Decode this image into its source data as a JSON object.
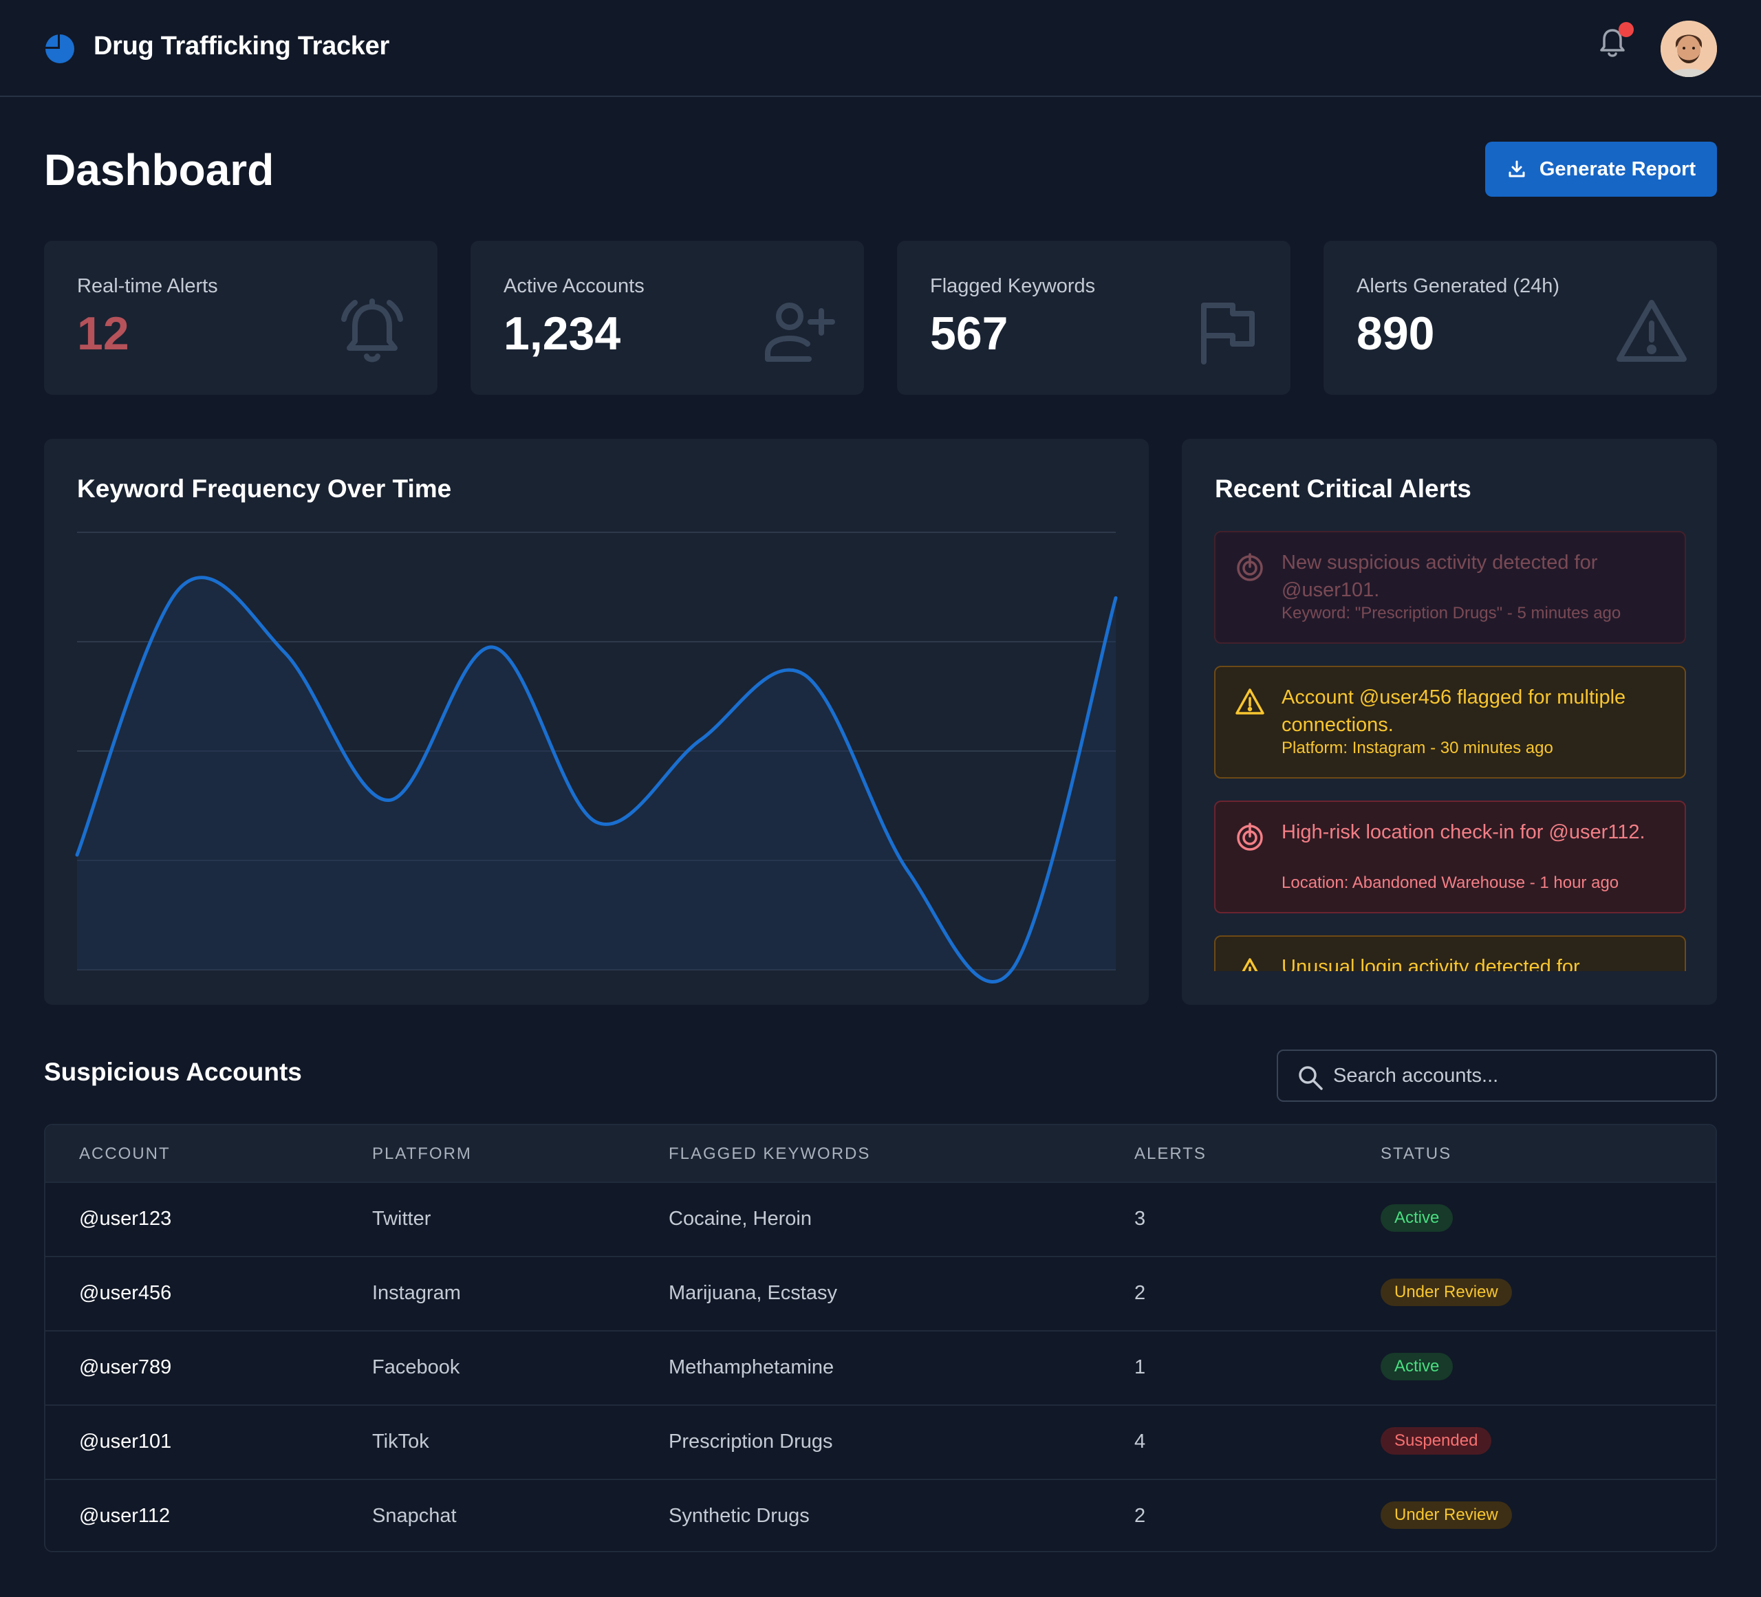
{
  "app": {
    "title": "Drug Trafficking Tracker"
  },
  "header": {
    "notification_icon": "bell-icon",
    "has_unread": true
  },
  "page": {
    "title": "Dashboard",
    "generate_report_label": "Generate Report"
  },
  "stats": [
    {
      "label": "Real-time Alerts",
      "value": "12",
      "icon": "bell-ringing-icon",
      "value_color": "#b5525a"
    },
    {
      "label": "Active Accounts",
      "value": "1,234",
      "icon": "user-plus-icon"
    },
    {
      "label": "Flagged Keywords",
      "value": "567",
      "icon": "flag-icon"
    },
    {
      "label": "Alerts Generated (24h)",
      "value": "890",
      "icon": "warning-triangle-icon"
    }
  ],
  "chart": {
    "title": "Keyword Frequency Over Time"
  },
  "chart_data": {
    "type": "line",
    "title": "Keyword Frequency Over Time",
    "xlabel": "",
    "ylabel": "",
    "grid": true,
    "gridlines": 5,
    "color": "#1a6fd0",
    "x": [
      0,
      0.1,
      0.2,
      0.3,
      0.4,
      0.5,
      0.6,
      0.7,
      0.8,
      0.9,
      1.0
    ],
    "series": [
      {
        "values": [
          1.05,
          3.5,
          2.9,
          1.55,
          2.95,
          1.35,
          2.1,
          2.7,
          0.9,
          0.0,
          3.4
        ]
      }
    ],
    "ylim": [
      0,
      4
    ]
  },
  "alerts_panel": {
    "title": "Recent Critical Alerts",
    "items": [
      {
        "type": "danger-muted",
        "icon": "target-alert-icon",
        "message": "New suspicious activity detected for @user101.",
        "meta": "Keyword: \"Prescription Drugs\" - 5 minutes ago"
      },
      {
        "type": "warning",
        "icon": "warning-triangle-icon",
        "message": "Account @user456 flagged for multiple connections.",
        "meta": "Platform: Instagram - 30 minutes ago"
      },
      {
        "type": "danger",
        "icon": "target-alert-icon",
        "message": "High-risk location check-in for @user112.",
        "meta": "Location: Abandoned Warehouse - 1 hour ago"
      },
      {
        "type": "warning",
        "icon": "warning-triangle-icon",
        "message": "Unusual login activity detected for",
        "meta": ""
      }
    ]
  },
  "accounts": {
    "title": "Suspicious Accounts",
    "search_placeholder": "Search accounts...",
    "columns": [
      "ACCOUNT",
      "PLATFORM",
      "FLAGGED KEYWORDS",
      "ALERTS",
      "STATUS"
    ],
    "rows": [
      {
        "account": "@user123",
        "platform": "Twitter",
        "keywords": "Cocaine, Heroin",
        "alerts": "3",
        "status": "Active",
        "status_type": "active"
      },
      {
        "account": "@user456",
        "platform": "Instagram",
        "keywords": "Marijuana, Ecstasy",
        "alerts": "2",
        "status": "Under Review",
        "status_type": "review"
      },
      {
        "account": "@user789",
        "platform": "Facebook",
        "keywords": "Methamphetamine",
        "alerts": "1",
        "status": "Active",
        "status_type": "active"
      },
      {
        "account": "@user101",
        "platform": "TikTok",
        "keywords": "Prescription Drugs",
        "alerts": "4",
        "status": "Suspended",
        "status_type": "suspended"
      },
      {
        "account": "@user112",
        "platform": "Snapchat",
        "keywords": "Synthetic Drugs",
        "alerts": "2",
        "status": "Under Review",
        "status_type": "review"
      }
    ]
  }
}
